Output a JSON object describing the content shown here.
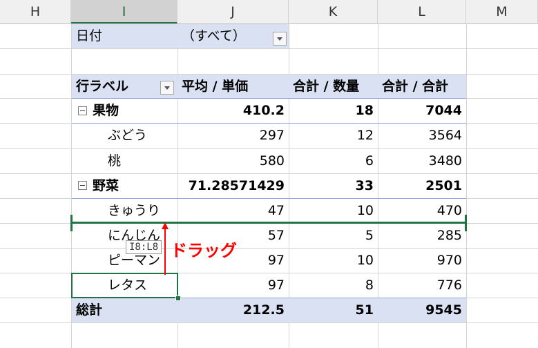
{
  "columns": [
    {
      "key": "H",
      "label": "H"
    },
    {
      "key": "I",
      "label": "I",
      "selected": true
    },
    {
      "key": "J",
      "label": "J"
    },
    {
      "key": "K",
      "label": "K"
    },
    {
      "key": "L",
      "label": "L"
    },
    {
      "key": "M",
      "label": "M"
    }
  ],
  "filter": {
    "label": "日付",
    "value": "（すべて）"
  },
  "pivot": {
    "headers": {
      "row_label": "行ラベル",
      "avg_price": "平均 / 単価",
      "sum_qty": "合計 / 数量",
      "sum_total": "合計 / 合計"
    },
    "groups": [
      {
        "name": "果物",
        "avg": "410.2",
        "qty": "18",
        "total": "7044",
        "items": [
          {
            "name": "ぶどう",
            "avg": "297",
            "qty": "12",
            "total": "3564"
          },
          {
            "name": "桃",
            "avg": "580",
            "qty": "6",
            "total": "3480"
          }
        ]
      },
      {
        "name": "野菜",
        "avg": "71.28571429",
        "qty": "33",
        "total": "2501",
        "items": [
          {
            "name": "きゅうり",
            "avg": "47",
            "qty": "10",
            "total": "470"
          },
          {
            "name": "にんじん",
            "avg": "57",
            "qty": "5",
            "total": "285"
          },
          {
            "name": "ピーマン",
            "avg": "97",
            "qty": "10",
            "total": "970"
          },
          {
            "name": "レタス",
            "avg": "97",
            "qty": "8",
            "total": "776"
          }
        ]
      }
    ],
    "grand_total": {
      "label": "総計",
      "avg": "212.5",
      "qty": "51",
      "total": "9545"
    }
  },
  "drag": {
    "tooltip": "I8:L8",
    "label": "ドラッグ"
  },
  "colors": {
    "accent": "#217346",
    "band": "#d9e1f2",
    "drag_label": "#ff0000"
  }
}
